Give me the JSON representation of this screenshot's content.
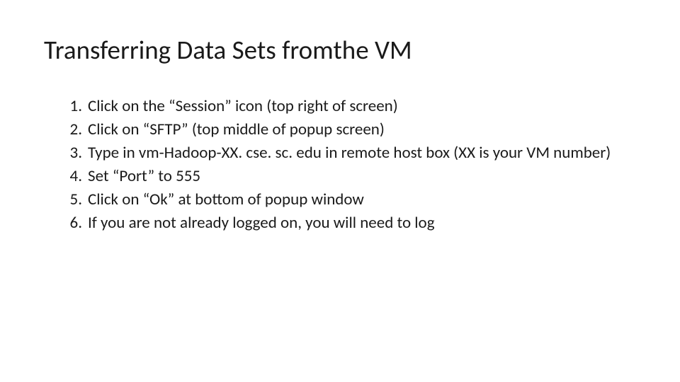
{
  "title": "Transferring Data Sets fromthe VM",
  "steps": [
    {
      "marker": "1.",
      "text": "Click on the “Session” icon (top right of screen)"
    },
    {
      "marker": "2.",
      "text": "Click on “SFTP” (top middle of popup screen)"
    },
    {
      "marker": "3.",
      "text": "Type in vm-Hadoop-XX. cse. sc. edu in remote host box (XX is your VM number)"
    },
    {
      "marker": "4.",
      "text": "Set “Port” to 555"
    },
    {
      "marker": "5.",
      "text": "Click on “Ok” at bottom of popup window"
    },
    {
      "marker": "6.",
      "text": "If you are not already logged on, you will need to log"
    }
  ]
}
